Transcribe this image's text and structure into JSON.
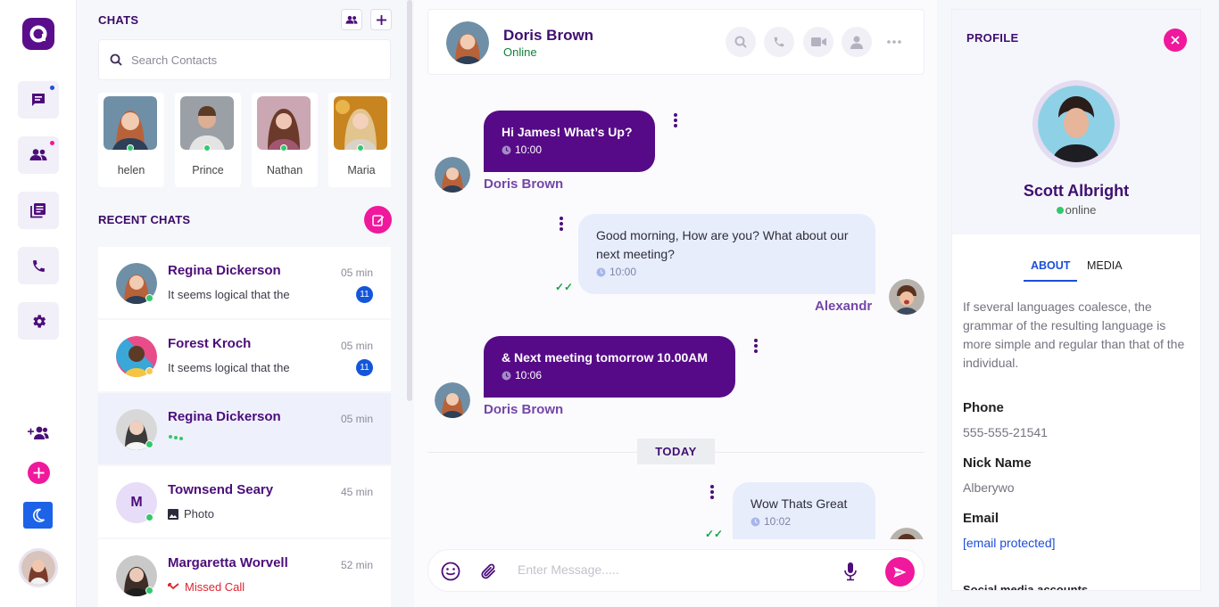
{
  "colors": {
    "brand": "#5b0e8c",
    "accent_pink": "#f0189c",
    "incoming_bubble": "#560a87",
    "outgoing_bubble": "#e8edfc",
    "online": "#34c86b",
    "badge_blue": "#1456d9"
  },
  "rail": {
    "icons": [
      "logo-icon",
      "chat-icon",
      "users-icon",
      "book-icon",
      "phone-icon",
      "settings-icon",
      "add-user-icon",
      "add-icon",
      "moon-icon"
    ]
  },
  "chats": {
    "title": "CHATS",
    "search_placeholder": "Search Contacts",
    "stories": [
      {
        "name": "helen"
      },
      {
        "name": "Prince"
      },
      {
        "name": "Nathan"
      },
      {
        "name": "Maria"
      }
    ],
    "recent_title": "RECENT CHATS",
    "items": [
      {
        "name": "Regina Dickerson",
        "message": "It seems logical that the",
        "time": "05 min",
        "unread": "11"
      },
      {
        "name": "Forest Kroch",
        "message": "It seems logical that the",
        "time": "05 min",
        "unread": "11"
      },
      {
        "name": "Regina Dickerson",
        "message": "",
        "time": "05 min"
      },
      {
        "name": "Townsend Seary",
        "message": "Photo",
        "time": "45 min",
        "initial": "M"
      },
      {
        "name": "Margaretta Worvell",
        "message": "Missed Call",
        "time": "52 min"
      }
    ]
  },
  "conversation": {
    "contact_name": "Doris Brown",
    "contact_status": "Online",
    "messages": [
      {
        "text": "Hi James! What’s Up?",
        "time": "10:00",
        "sender": "Doris Brown"
      },
      {
        "text": "Good morning, How are you? What about our next meeting?",
        "time": "10:00",
        "sender": "Alexandr"
      },
      {
        "text": "& Next meeting tomorrow 10.00AM",
        "time": "10:06",
        "sender": "Doris Brown"
      },
      {
        "text": "Wow Thats Great",
        "time": "10:02"
      }
    ],
    "divider": "TODAY",
    "input_placeholder": "Enter Message....."
  },
  "profile": {
    "title": "PROFILE",
    "name": "Scott Albright",
    "status": "online",
    "tabs": [
      "ABOUT",
      "MEDIA"
    ],
    "about": "If several languages coalesce, the grammar of the resulting language is more simple and regular than that of the individual.",
    "phone_label": "Phone",
    "phone": "555-555-21541",
    "nick_label": "Nick Name",
    "nick": "Alberywo",
    "email_label": "Email",
    "email": "[email protected]",
    "social_label": "Social media accounts"
  }
}
